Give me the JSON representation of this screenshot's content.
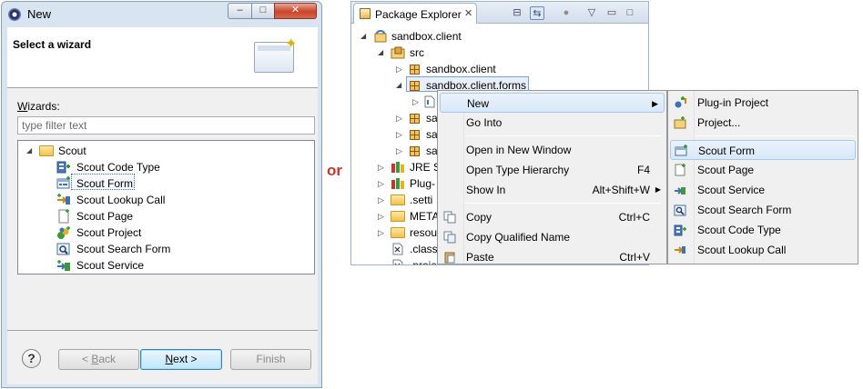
{
  "wizard": {
    "title": "New",
    "header_title": "Select a wizard",
    "wizards_label_underlined": "W",
    "wizards_label_rest": "izards:",
    "filter_placeholder": "type filter text",
    "folder": "Scout",
    "items": [
      {
        "label": "Scout Code Type",
        "icon": "code-type-icon"
      },
      {
        "label": "Scout Form",
        "icon": "form-icon",
        "selected": true
      },
      {
        "label": "Scout Lookup Call",
        "icon": "lookup-call-icon"
      },
      {
        "label": "Scout Page",
        "icon": "page-icon"
      },
      {
        "label": "Scout Project",
        "icon": "project-icon"
      },
      {
        "label": "Scout Search Form",
        "icon": "search-form-icon"
      },
      {
        "label": "Scout Service",
        "icon": "service-icon"
      }
    ],
    "help": "?",
    "back_prefix": "< ",
    "back_key": "B",
    "back_rest": "ack",
    "next_key": "N",
    "next_rest": "ext >",
    "finish": "Finish",
    "window_controls": {
      "minimize": "–",
      "maximize": "□",
      "close": "✕"
    }
  },
  "or_text": "or",
  "package_explorer": {
    "tab_label": "Package Explorer",
    "tab_close": "✕",
    "tree": [
      {
        "label": "sandbox.client"
      },
      {
        "label": "src"
      },
      {
        "label": "sandbox.client"
      },
      {
        "label": "sandbox.client.forms"
      },
      {
        "label": "sa"
      },
      {
        "label": "sa"
      },
      {
        "label": "sa"
      },
      {
        "label": "JRE S"
      },
      {
        "label": "Plug-"
      },
      {
        "label": ".setti"
      },
      {
        "label": "META"
      },
      {
        "label": "resou"
      },
      {
        "label": ".class"
      },
      {
        "label": ".proje"
      }
    ]
  },
  "context_menu": {
    "new": "New",
    "go_into": "Go Into",
    "open_new_window": "Open in New Window",
    "open_type_hierarchy": "Open Type Hierarchy",
    "open_type_hierarchy_accel": "F4",
    "show_in": "Show In",
    "show_in_accel": "Alt+Shift+W",
    "copy": "Copy",
    "copy_accel": "Ctrl+C",
    "copy_qualified_name": "Copy Qualified Name",
    "paste": "Paste",
    "paste_accel": "Ctrl+V"
  },
  "submenu": {
    "items": [
      "Plug-in Project",
      "Project...",
      "Scout Form",
      "Scout Page",
      "Scout Service",
      "Scout Search Form",
      "Scout Code Type",
      "Scout Lookup Call"
    ]
  }
}
